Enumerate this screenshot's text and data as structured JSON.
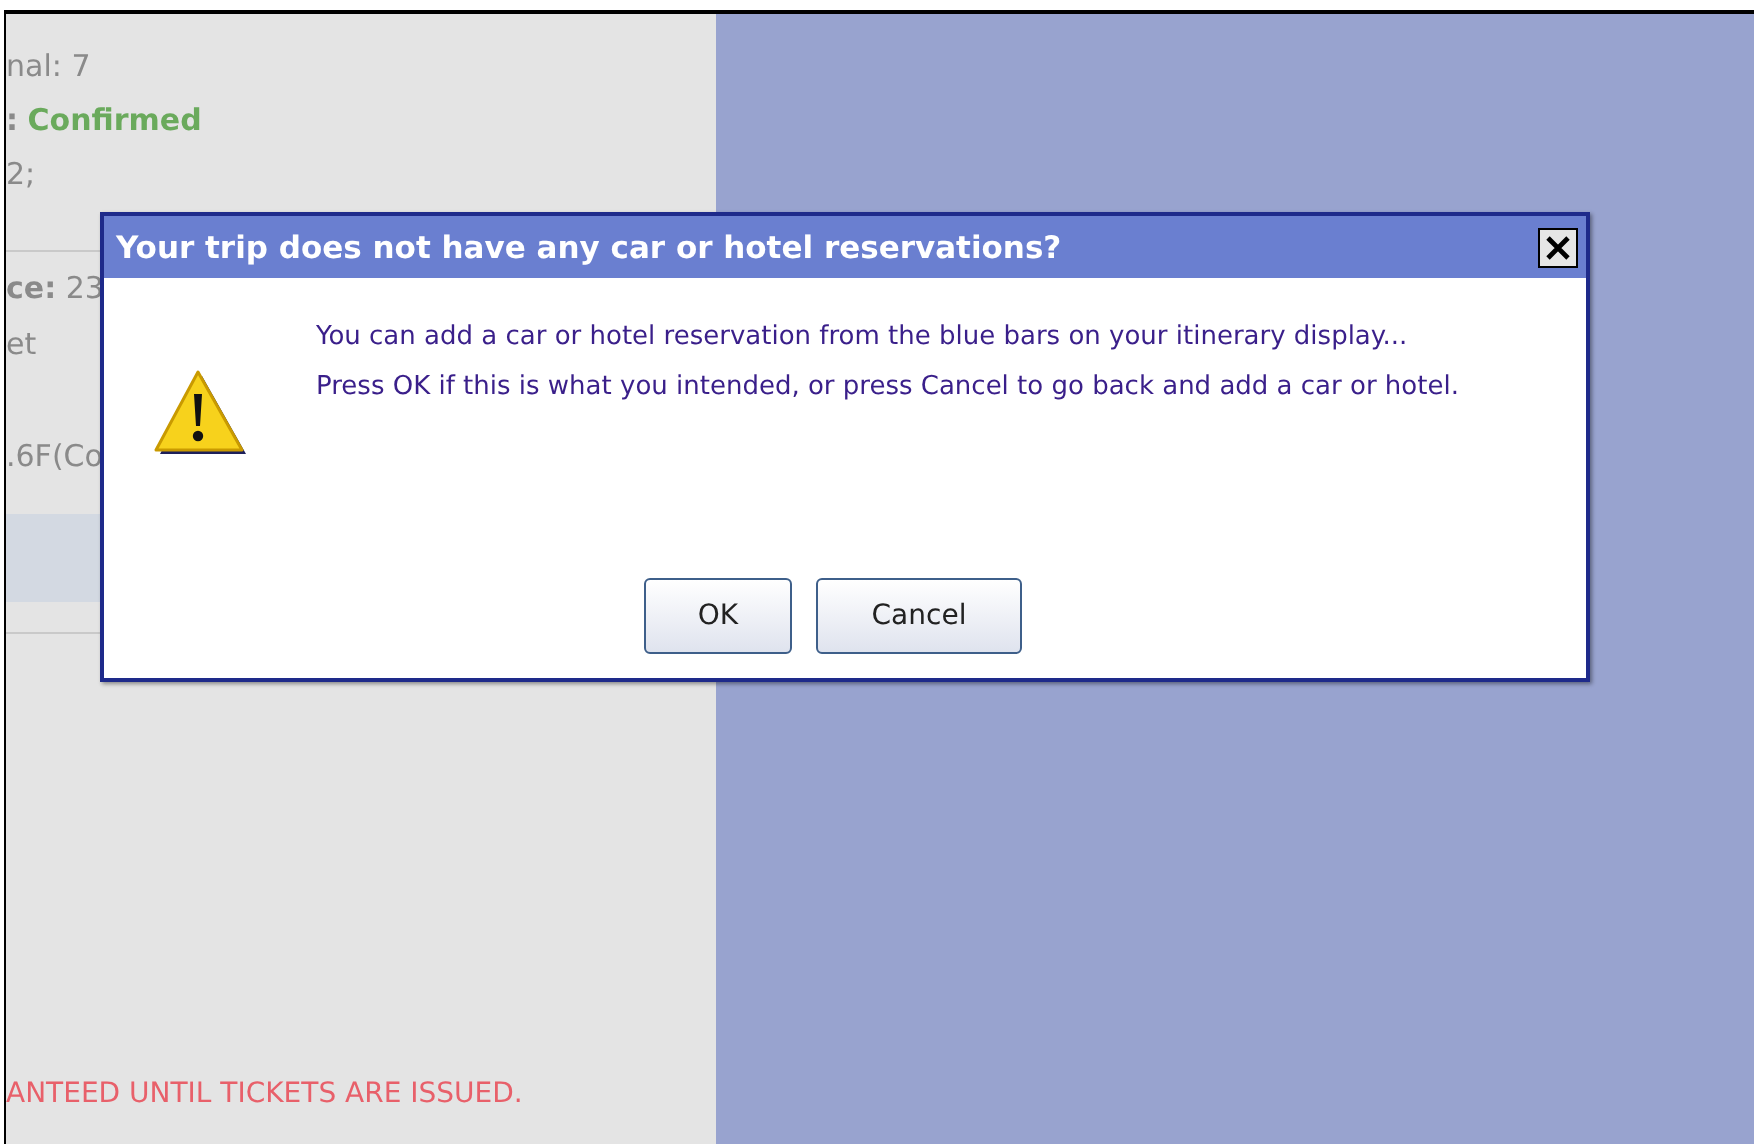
{
  "background": {
    "top_lines": [
      {
        "kind": "blank"
      },
      {
        "kind": "plain",
        "text": "nal: 7"
      },
      {
        "kind": "status",
        "text": ":",
        "value": "Confirmed"
      },
      {
        "kind": "plain",
        "text": "2;"
      }
    ],
    "middle_lines": [
      {
        "kind": "plain",
        "text": "**ce:** 23"
      },
      {
        "kind": "plain",
        "text": "et"
      },
      {
        "kind": "blank"
      },
      {
        "kind": "plain",
        "text": ".6F(Co"
      }
    ],
    "notice": "ANTEED UNTIL TICKETS ARE ISSUED."
  },
  "dialog": {
    "title": "Your trip does not have any car or hotel reservations?",
    "messages": [
      "You can add a car or hotel reservation from the blue bars on your itinerary display...",
      "Press OK if this is what you intended, or press Cancel to go back and add a car or hotel."
    ],
    "buttons": [
      "OK",
      "Cancel"
    ]
  }
}
